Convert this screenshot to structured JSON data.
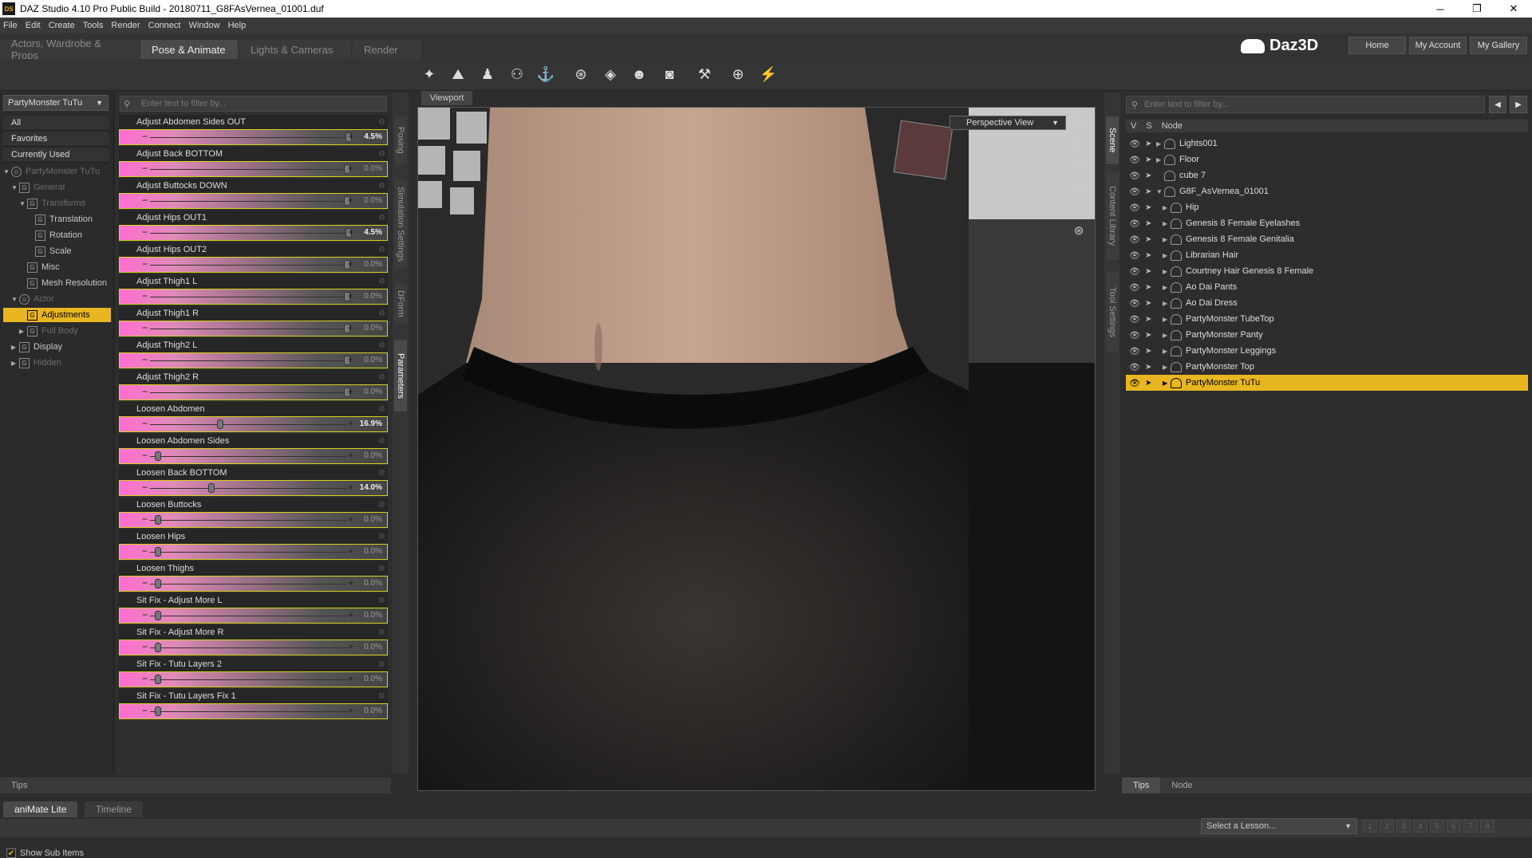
{
  "window": {
    "title": "DAZ Studio 4.10 Pro Public Build - 20180711_G8FAsVernea_01001.duf",
    "app_icon": "DS",
    "minimize": "─",
    "maximize": "❐",
    "close": "✕"
  },
  "menu": [
    "File",
    "Edit",
    "Create",
    "Tools",
    "Render",
    "Connect",
    "Window",
    "Help"
  ],
  "main_tabs": [
    "Actors, Wardrobe & Props",
    "Pose & Animate",
    "Lights & Cameras",
    "Render"
  ],
  "brand": {
    "logo": "Daz3D",
    "buttons": [
      "Home",
      "My Account",
      "My Gallery"
    ]
  },
  "left": {
    "node_select": "PartyMonster TuTu",
    "categories": [
      "All",
      "Favorites",
      "Currently Used"
    ],
    "tree": [
      {
        "label": "PartyMonster TuTu",
        "dim": true
      },
      {
        "label": "General",
        "dim": true
      },
      {
        "label": "Transforms",
        "dim": true
      },
      {
        "label": "Translation",
        "dim": false
      },
      {
        "label": "Rotation",
        "dim": false
      },
      {
        "label": "Scale",
        "dim": false
      },
      {
        "label": "Misc",
        "dim": false
      },
      {
        "label": "Mesh Resolution",
        "dim": false
      },
      {
        "label": "Actor",
        "dim": true
      },
      {
        "label": "Adjustments",
        "dim": false
      },
      {
        "label": "Full Body",
        "dim": true
      },
      {
        "label": "Display",
        "dim": false
      },
      {
        "label": "Hidden",
        "dim": true
      }
    ],
    "show_sub_items": "Show Sub Items"
  },
  "params": {
    "filter_placeholder": "Enter text to filter by...",
    "sliders": [
      {
        "label": "Adjust Abdomen Sides OUT",
        "value": "4.5%",
        "pos": 0.47,
        "active": true
      },
      {
        "label": "Adjust Back BOTTOM",
        "value": "0.0%",
        "pos": 0.45,
        "active": false
      },
      {
        "label": "Adjust Buttocks DOWN",
        "value": "0.0%",
        "pos": 0.45,
        "active": false
      },
      {
        "label": "Adjust Hips OUT1",
        "value": "4.5%",
        "pos": 0.47,
        "active": true
      },
      {
        "label": "Adjust Hips OUT2",
        "value": "0.0%",
        "pos": 0.45,
        "active": false
      },
      {
        "label": "Adjust Thigh1 L",
        "value": "0.0%",
        "pos": 0.45,
        "active": false
      },
      {
        "label": "Adjust Thigh1 R",
        "value": "0.0%",
        "pos": 0.45,
        "active": false
      },
      {
        "label": "Adjust Thigh2 L",
        "value": "0.0%",
        "pos": 0.45,
        "active": false
      },
      {
        "label": "Adjust Thigh2 R",
        "value": "0.0%",
        "pos": 0.45,
        "active": false
      },
      {
        "label": "Loosen Abdomen",
        "value": "16.9%",
        "pos": 0.16,
        "active": true
      },
      {
        "label": "Loosen Abdomen Sides",
        "value": "0.0%",
        "pos": 0.0,
        "active": false
      },
      {
        "label": "Loosen Back BOTTOM",
        "value": "14.0%",
        "pos": 0.14,
        "active": true
      },
      {
        "label": "Loosen Buttocks",
        "value": "0.0%",
        "pos": 0.0,
        "active": false
      },
      {
        "label": "Loosen Hips",
        "value": "0.0%",
        "pos": 0.0,
        "active": false
      },
      {
        "label": "Loosen Thighs",
        "value": "0.0%",
        "pos": 0.0,
        "active": false
      },
      {
        "label": "Sit Fix - Adjust More L",
        "value": "0.0%",
        "pos": 0.0,
        "active": false
      },
      {
        "label": "Sit Fix - Adjust More R",
        "value": "0.0%",
        "pos": 0.0,
        "active": false
      },
      {
        "label": "Sit Fix - Tutu Layers 2",
        "value": "0.0%",
        "pos": 0.0,
        "active": false
      },
      {
        "label": "Sit Fix - Tutu Layers Fix 1",
        "value": "0.0%",
        "pos": 0.0,
        "active": false
      }
    ]
  },
  "side_tabs_left": [
    "Posing",
    "Simulation Settings",
    "DForm",
    "Parameters"
  ],
  "viewport": {
    "tab": "Viewport",
    "view": "Perspective View"
  },
  "side_tabs_right": [
    "Scene",
    "Content Library",
    "Tool Settings"
  ],
  "scene": {
    "filter_placeholder": "Enter text to filter by...",
    "columns": [
      "V",
      "S",
      "Node"
    ],
    "nodes": [
      {
        "label": "Lights001",
        "indent": 0,
        "expand": "▶"
      },
      {
        "label": "Floor",
        "indent": 0,
        "expand": "▶"
      },
      {
        "label": "cube 7",
        "indent": 0,
        "expand": ""
      },
      {
        "label": "G8F_AsVernea_01001",
        "indent": 0,
        "expand": "▼"
      },
      {
        "label": "Hip",
        "indent": 1,
        "expand": "▶"
      },
      {
        "label": "Genesis 8 Female Eyelashes",
        "indent": 1,
        "expand": "▶"
      },
      {
        "label": "Genesis 8 Female Genitalia",
        "indent": 1,
        "expand": "▶"
      },
      {
        "label": "Librarian Hair",
        "indent": 1,
        "expand": "▶"
      },
      {
        "label": "Courtney Hair Genesis 8 Female",
        "indent": 1,
        "expand": "▶"
      },
      {
        "label": "Ao Dai Pants",
        "indent": 1,
        "expand": "▶"
      },
      {
        "label": "Ao Dai Dress",
        "indent": 1,
        "expand": "▶"
      },
      {
        "label": "PartyMonster TubeTop",
        "indent": 1,
        "expand": "▶"
      },
      {
        "label": "PartyMonster Panty",
        "indent": 1,
        "expand": "▶"
      },
      {
        "label": "PartyMonster Leggings",
        "indent": 1,
        "expand": "▶"
      },
      {
        "label": "PartyMonster Top",
        "indent": 1,
        "expand": "▶"
      },
      {
        "label": "PartyMonster TuTu",
        "indent": 1,
        "expand": "▶",
        "selected": true
      }
    ]
  },
  "bottom": {
    "tips": "Tips",
    "scene_tabs": [
      "Tips",
      "Node"
    ],
    "dock_tabs": [
      "aniMate Lite",
      "Timeline"
    ],
    "lesson": "Select a Lesson...",
    "pages": [
      "1",
      "2",
      "3",
      "4",
      "5",
      "6",
      "7",
      "8"
    ]
  },
  "colors": {
    "accent": "#e8b620",
    "slider_fill": "#ff6ed0"
  }
}
